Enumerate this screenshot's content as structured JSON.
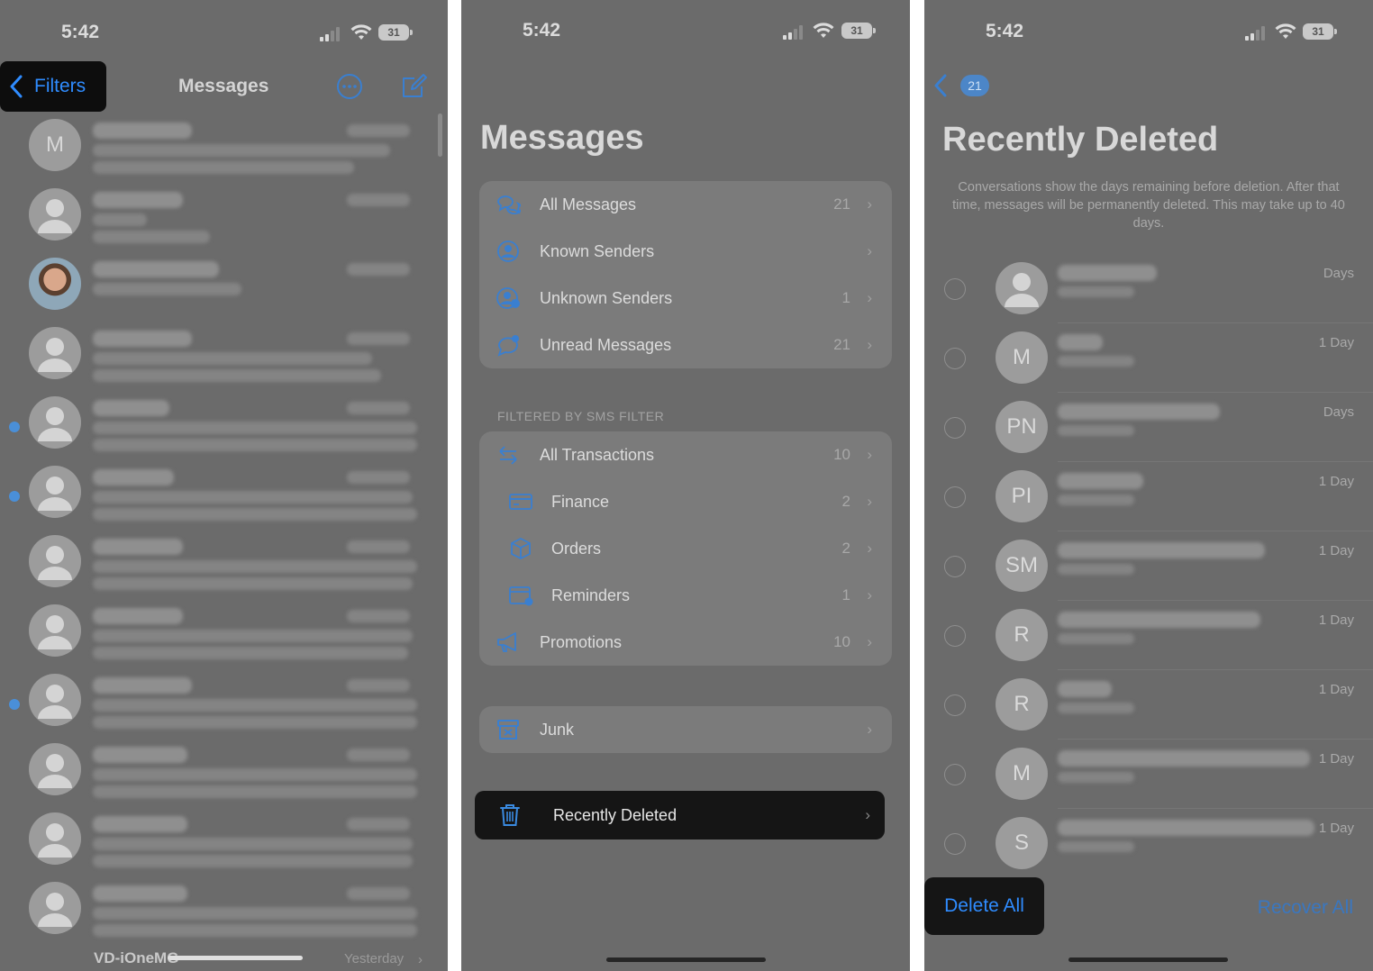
{
  "status_bar": {
    "time": "5:42",
    "battery": "31"
  },
  "panel1": {
    "back_label": "Filters",
    "title": "Messages",
    "conversations": [
      {
        "avatar": "M",
        "type": "initial",
        "unread": false
      },
      {
        "avatar": "",
        "type": "person",
        "unread": false
      },
      {
        "avatar": "",
        "type": "photo",
        "unread": false
      },
      {
        "avatar": "",
        "type": "person",
        "unread": false
      },
      {
        "avatar": "",
        "type": "person",
        "unread": true
      },
      {
        "avatar": "",
        "type": "person",
        "unread": true
      },
      {
        "avatar": "",
        "type": "person",
        "unread": false
      },
      {
        "avatar": "",
        "type": "person",
        "unread": false
      },
      {
        "avatar": "",
        "type": "person",
        "unread": true
      },
      {
        "avatar": "",
        "type": "person",
        "unread": false
      },
      {
        "avatar": "",
        "type": "person",
        "unread": false
      },
      {
        "avatar": "",
        "type": "person",
        "unread": false
      }
    ],
    "last_row": {
      "name": "VD-iOneMG",
      "time": "Yesterday"
    }
  },
  "panel2": {
    "title": "Messages",
    "filters": [
      {
        "label": "All Messages",
        "count": "21",
        "icon": "chat-bubbles-icon"
      },
      {
        "label": "Known Senders",
        "count": "",
        "icon": "person-circle-icon"
      },
      {
        "label": "Unknown Senders",
        "count": "1",
        "icon": "person-question-icon"
      },
      {
        "label": "Unread Messages",
        "count": "21",
        "icon": "unread-bubble-icon"
      }
    ],
    "section_header": "FILTERED BY SMS FILTER",
    "sms_filters": [
      {
        "label": "All Transactions",
        "count": "10",
        "icon": "arrows-icon"
      },
      {
        "label": "Finance",
        "count": "2",
        "icon": "card-icon"
      },
      {
        "label": "Orders",
        "count": "2",
        "icon": "box-icon"
      },
      {
        "label": "Reminders",
        "count": "1",
        "icon": "calendar-icon"
      },
      {
        "label": "Promotions",
        "count": "10",
        "icon": "megaphone-icon"
      }
    ],
    "junk": {
      "label": "Junk"
    },
    "recently_deleted": {
      "label": "Recently Deleted"
    }
  },
  "panel3": {
    "back_badge": "21",
    "title": "Recently Deleted",
    "description": "Conversations show the days remaining before deletion. After that time, messages will be permanently deleted. This may take up to 40 days.",
    "items": [
      {
        "avatar": "",
        "days": "Days"
      },
      {
        "avatar": "M",
        "days": "1 Day"
      },
      {
        "avatar": "PN",
        "days": "Days"
      },
      {
        "avatar": "PI",
        "days": "1 Day"
      },
      {
        "avatar": "SM",
        "days": "1 Day"
      },
      {
        "avatar": "R",
        "days": "1 Day"
      },
      {
        "avatar": "R",
        "days": "1 Day"
      },
      {
        "avatar": "M",
        "days": "1 Day"
      },
      {
        "avatar": "S",
        "days": "1 Day"
      }
    ],
    "delete_all": "Delete All",
    "recover_all": "Recover All"
  },
  "colors": {
    "accent": "#2f8cff",
    "dim_background": "#6b6b6b",
    "highlight": "#151515"
  }
}
